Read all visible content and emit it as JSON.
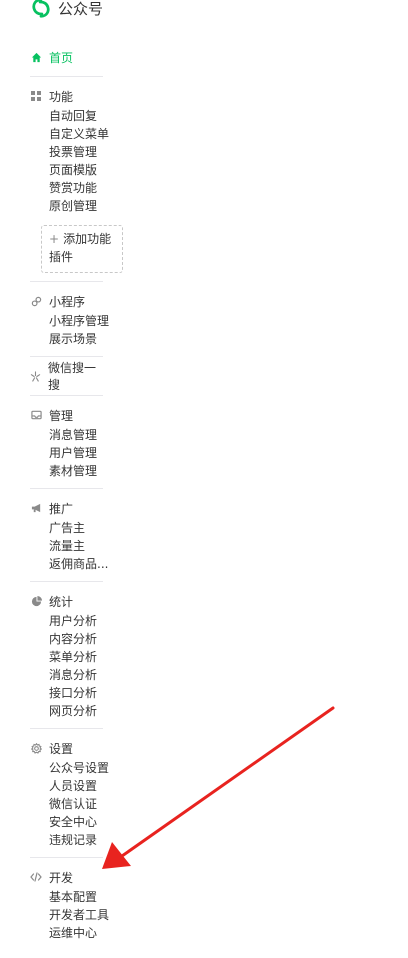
{
  "header": {
    "title": "公众号"
  },
  "colors": {
    "accent": "#07c160",
    "arrow": "#e8231f"
  },
  "nav": {
    "home": "首页",
    "sections": [
      {
        "key": "features",
        "title": "功能",
        "icon": "grid-icon",
        "items": [
          "自动回复",
          "自定义菜单",
          "投票管理",
          "页面模版",
          "赞赏功能",
          "原创管理"
        ],
        "add_feature": "添加功能",
        "add_feature_2": "插件"
      },
      {
        "key": "miniprogram",
        "title": "小程序",
        "icon": "link-icon",
        "items": [
          "小程序管理",
          "展示场景"
        ]
      },
      {
        "key": "search",
        "title": "微信搜一搜",
        "icon": "sparkle-icon",
        "items": []
      },
      {
        "key": "manage",
        "title": "管理",
        "icon": "inbox-icon",
        "items": [
          "消息管理",
          "用户管理",
          "素材管理"
        ]
      },
      {
        "key": "promote",
        "title": "推广",
        "icon": "megaphone-icon",
        "items": [
          "广告主",
          "流量主",
          "返佣商品..."
        ]
      },
      {
        "key": "stats",
        "title": "统计",
        "icon": "pie-chart-icon",
        "items": [
          "用户分析",
          "内容分析",
          "菜单分析",
          "消息分析",
          "接口分析",
          "网页分析"
        ]
      },
      {
        "key": "settings",
        "title": "设置",
        "icon": "gear-icon",
        "items": [
          "公众号设置",
          "人员设置",
          "微信认证",
          "安全中心",
          "违规记录"
        ]
      },
      {
        "key": "develop",
        "title": "开发",
        "icon": "code-icon",
        "items": [
          "基本配置",
          "开发者工具",
          "运维中心"
        ]
      }
    ]
  }
}
